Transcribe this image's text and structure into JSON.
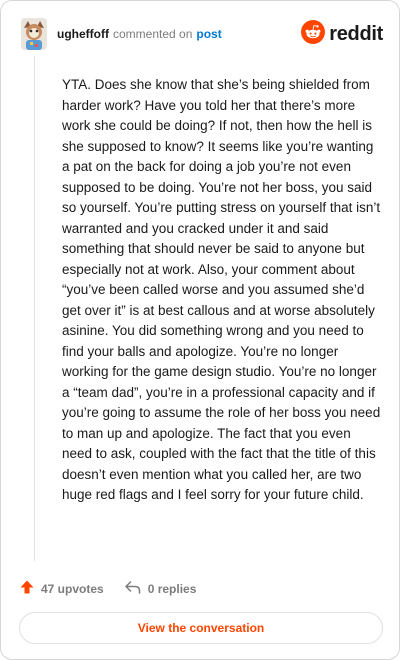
{
  "header": {
    "username": "ugheffoff",
    "action_text": "commented on",
    "post_link": "post",
    "brand_name": "reddit"
  },
  "comment": {
    "text": "YTA. Does she know that she’s being shielded from harder work? Have you told her that there’s more work she could be doing? If not, then how the hell is she supposed to know? It seems like you’re wanting a pat on the back for doing a job you’re not even supposed to be doing. You’re not her boss, you said so yourself. You’re putting stress on yourself that isn’t warranted and you cracked under it and said something that should never be said to anyone but especially not at work. Also, your comment about “you’ve been called worse and you assumed she’d get over it” is at best callous and at worse absolutely asinine. You did something wrong and you need to find your balls and apologize. You’re no longer working for the game design studio. You’re no longer a “team dad”, you’re in a professional capacity and if you’re going to assume the role of her boss you need to man up and apologize. The fact that you even need to ask, coupled with the fact that the title of this doesn’t even mention what you called her, are two huge red flags and I feel sorry for your future child."
  },
  "actions": {
    "upvotes": "47 upvotes",
    "replies": "0 replies"
  },
  "footer": {
    "button_label": "View the conversation"
  },
  "colors": {
    "accent": "#ff4500",
    "link": "#0079d3",
    "muted": "#7c7c7c"
  },
  "icons": [
    "avatar",
    "reddit-logo-icon",
    "upvote-arrow-icon",
    "reply-arrow-icon"
  ]
}
